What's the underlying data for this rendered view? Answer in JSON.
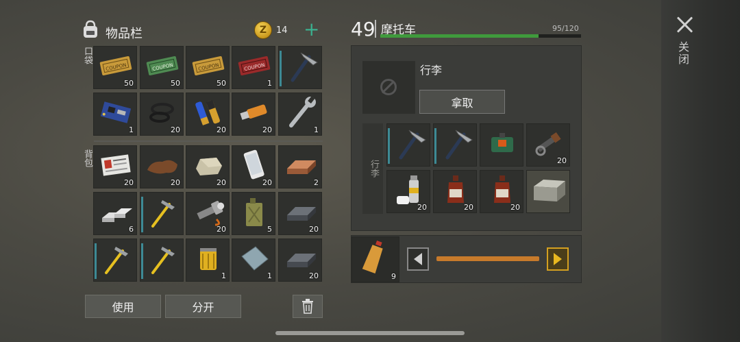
{
  "inventory": {
    "title": "物品栏",
    "coins": "14",
    "plus": "+",
    "pocket_label": "口袋",
    "backpack_label": "背包",
    "pocket_items": [
      {
        "name": "coupon-gold-1",
        "count": "50"
      },
      {
        "name": "ration-coupon",
        "count": "50"
      },
      {
        "name": "coupon-gold-2",
        "count": "50"
      },
      {
        "name": "combat-coupon",
        "count": "1"
      },
      {
        "name": "pickaxe",
        "count": ""
      },
      {
        "name": "circuit-board",
        "count": "1"
      },
      {
        "name": "rubber-rings",
        "count": "20"
      },
      {
        "name": "batteries",
        "count": "20"
      },
      {
        "name": "usb-flash-drive",
        "count": "20"
      },
      {
        "name": "wrench",
        "count": "1"
      }
    ],
    "backpack_items": [
      {
        "name": "id-card",
        "count": "20"
      },
      {
        "name": "leather",
        "count": "20"
      },
      {
        "name": "stone",
        "count": "20"
      },
      {
        "name": "smartphone",
        "count": "20"
      },
      {
        "name": "copper-ingot",
        "count": "2"
      },
      {
        "name": "silver-bars",
        "count": "6"
      },
      {
        "name": "hammer",
        "count": ""
      },
      {
        "name": "flashlight",
        "count": "20"
      },
      {
        "name": "jerry-can",
        "count": "5"
      },
      {
        "name": "iron-ingot",
        "count": "20"
      },
      {
        "name": "hammer-2",
        "count": ""
      },
      {
        "name": "hammer-3",
        "count": ""
      },
      {
        "name": "oil-filter",
        "count": "1"
      },
      {
        "name": "metal-plate",
        "count": "1"
      },
      {
        "name": "iron-ingot-2",
        "count": "20"
      }
    ],
    "use_button": "使用",
    "split_button": "分开"
  },
  "vehicle": {
    "level": "49",
    "name": "摩托车",
    "capacity": "95/120",
    "capacity_fraction": 0.79,
    "luggage_title": "行李",
    "take_button": "拿取",
    "luggage_side_label": "行李",
    "luggage_items": [
      {
        "name": "pickaxe",
        "count": ""
      },
      {
        "name": "pickaxe-2",
        "count": ""
      },
      {
        "name": "explosive-charge",
        "count": ""
      },
      {
        "name": "weapon-parts",
        "count": "20"
      },
      {
        "name": "spray-can",
        "count": "20"
      },
      {
        "name": "medicine-bottle",
        "count": "20"
      },
      {
        "name": "medicine-bottle-2",
        "count": "20"
      },
      {
        "name": "metal-crate",
        "count": ""
      }
    ]
  },
  "fuel": {
    "item": "fuel-bottle",
    "count": "9"
  },
  "close_label": "关闭",
  "colors": {
    "accent_green": "#3bb08f",
    "capacity_bar": "#3f9a3c",
    "slider": "#c77a2b",
    "durability": "#3d8a95"
  }
}
